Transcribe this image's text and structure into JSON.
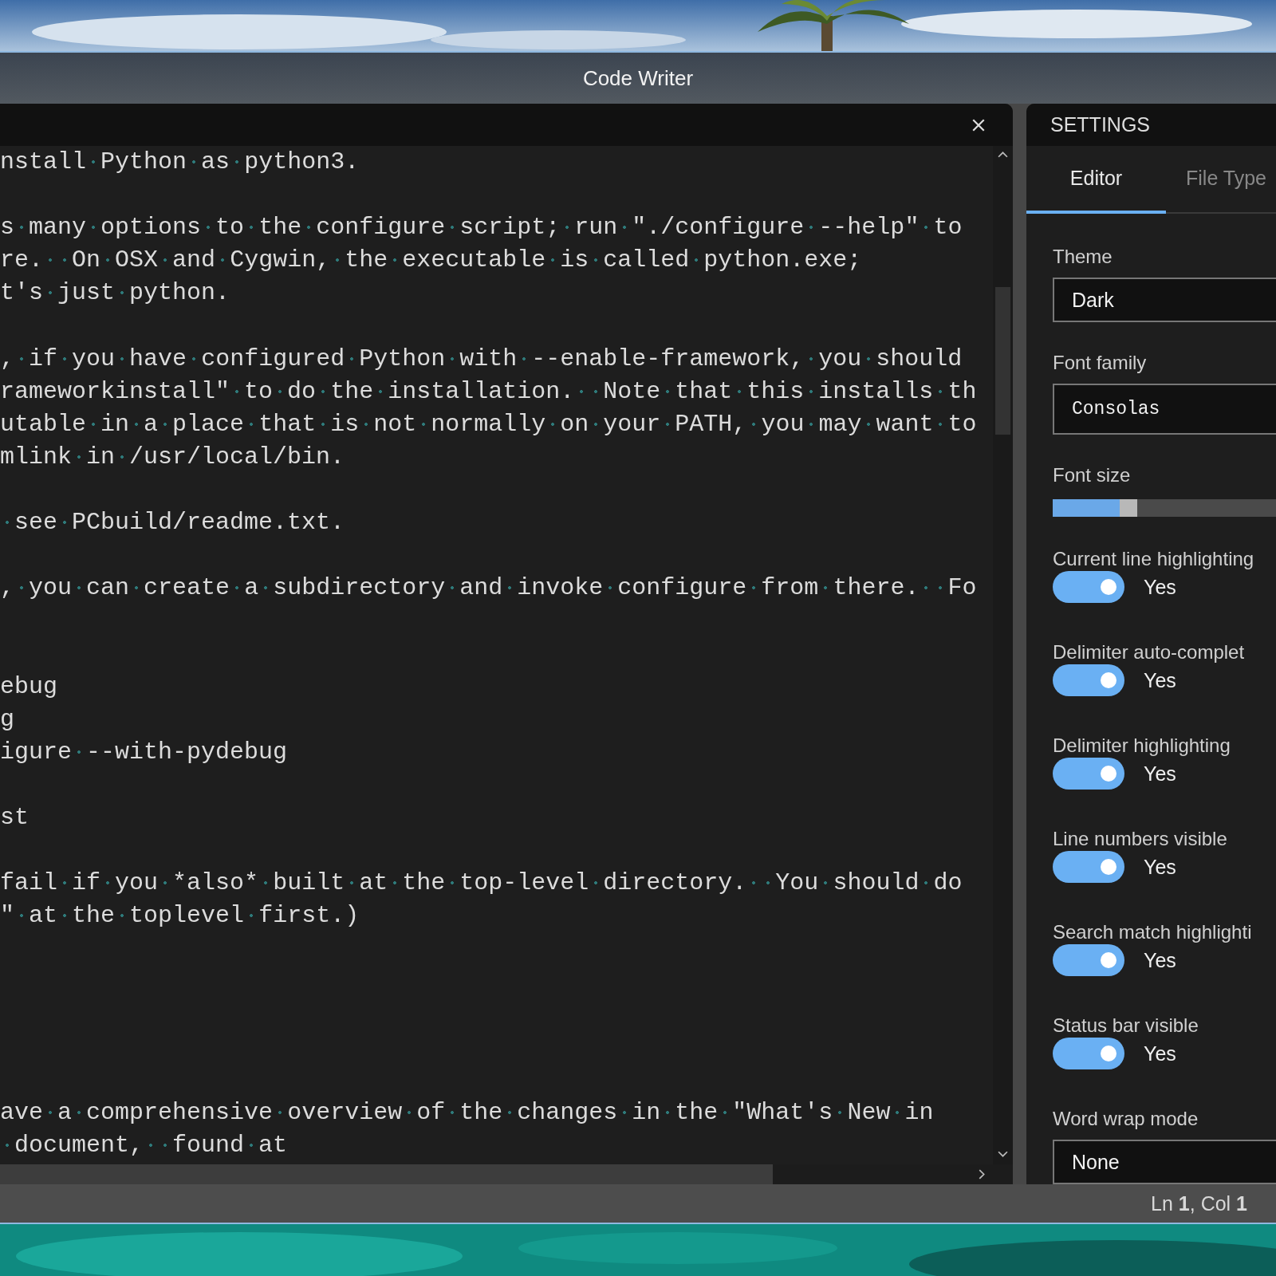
{
  "window": {
    "title": "Code Writer"
  },
  "editor": {
    "lines": [
      {
        "kind": "text",
        "text": "nstall Python as python3."
      },
      {
        "kind": "blank"
      },
      {
        "kind": "text",
        "text": "s many options to the configure script; run \"./configure --help\" to"
      },
      {
        "kind": "text",
        "text": "re.  On OSX and Cygwin, the executable is called python.exe;"
      },
      {
        "kind": "text",
        "text": "t's just python."
      },
      {
        "kind": "blank"
      },
      {
        "kind": "text",
        "text": ", if you have configured Python with --enable-framework, you should"
      },
      {
        "kind": "text",
        "text": "rameworkinstall\" to do the installation.  Note that this installs th"
      },
      {
        "kind": "text",
        "text": "utable in a place that is not normally on your PATH, you may want to"
      },
      {
        "kind": "text",
        "text": "mlink in /usr/local/bin."
      },
      {
        "kind": "blank"
      },
      {
        "kind": "text",
        "text": " see PCbuild/readme.txt."
      },
      {
        "kind": "blank"
      },
      {
        "kind": "text",
        "text": ", you can create a subdirectory and invoke configure from there.  Fo"
      },
      {
        "kind": "blank"
      },
      {
        "kind": "blank"
      },
      {
        "kind": "text",
        "text": "ebug"
      },
      {
        "kind": "text",
        "text": "g"
      },
      {
        "kind": "text",
        "text": "igure --with-pydebug"
      },
      {
        "kind": "blank"
      },
      {
        "kind": "text",
        "text": "st"
      },
      {
        "kind": "blank"
      },
      {
        "kind": "text",
        "text": "fail if you *also* built at the top-level directory.  You should do"
      },
      {
        "kind": "text",
        "text": "\" at the toplevel first.)"
      },
      {
        "kind": "blank"
      },
      {
        "kind": "blank"
      },
      {
        "kind": "blank"
      },
      {
        "kind": "blank"
      },
      {
        "kind": "blank"
      },
      {
        "kind": "text",
        "text": "ave a comprehensive overview of the changes in the \"What's New in"
      },
      {
        "kind": "text",
        "text": " document,  found at"
      }
    ]
  },
  "settings": {
    "title": "SETTINGS",
    "tabs": [
      {
        "label": "Editor",
        "selected": true
      },
      {
        "label": "File Type",
        "selected": false
      }
    ],
    "fields": [
      {
        "kind": "select",
        "label": "Theme",
        "value": "Dark",
        "mono": false
      },
      {
        "kind": "select",
        "label": "Font family",
        "value": "Consolas",
        "mono": true
      },
      {
        "kind": "slider",
        "label": "Font size",
        "level": 0.3
      },
      {
        "kind": "toggle",
        "label": "Current line highlighting",
        "on": true,
        "value": "Yes"
      },
      {
        "kind": "toggle",
        "label": "Delimiter auto-complet",
        "on": true,
        "value": "Yes"
      },
      {
        "kind": "toggle",
        "label": "Delimiter highlighting",
        "on": true,
        "value": "Yes"
      },
      {
        "kind": "toggle",
        "label": "Line numbers visible",
        "on": true,
        "value": "Yes"
      },
      {
        "kind": "toggle",
        "label": "Search match highlighti",
        "on": true,
        "value": "Yes"
      },
      {
        "kind": "toggle",
        "label": "Status bar visible",
        "on": true,
        "value": "Yes"
      },
      {
        "kind": "select",
        "label": "Word wrap mode",
        "value": "None",
        "mono": false
      }
    ]
  },
  "status_bar": {
    "position": "Ln **1**, Col **1**"
  }
}
